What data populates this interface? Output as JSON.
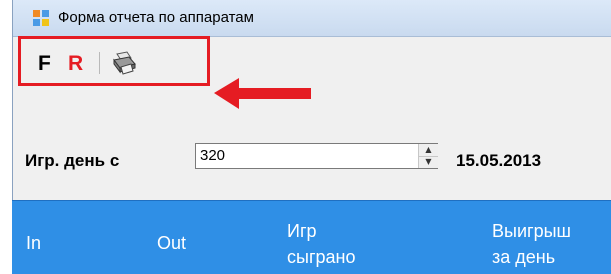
{
  "window": {
    "title": "Форма отчета по аппаратам",
    "icon": "form-window-icon"
  },
  "toolbar": {
    "f_label": "F",
    "r_label": "R",
    "print_icon": "printer-icon",
    "highlight_color": "#e51c23"
  },
  "annotation": {
    "arrow_color": "#e51c23",
    "arrow_icon": "left-arrow-icon"
  },
  "filter": {
    "day_label": "Игр. день с",
    "day_value": "320",
    "date_text": "15.05.2013"
  },
  "grid": {
    "header_color": "#2f8fe6",
    "columns": [
      {
        "line1": "In",
        "line2": ""
      },
      {
        "line1": "Out",
        "line2": ""
      },
      {
        "line1": "Игр",
        "line2": "сыграно"
      },
      {
        "line1": "Выигрыш",
        "line2": "за день"
      }
    ]
  }
}
